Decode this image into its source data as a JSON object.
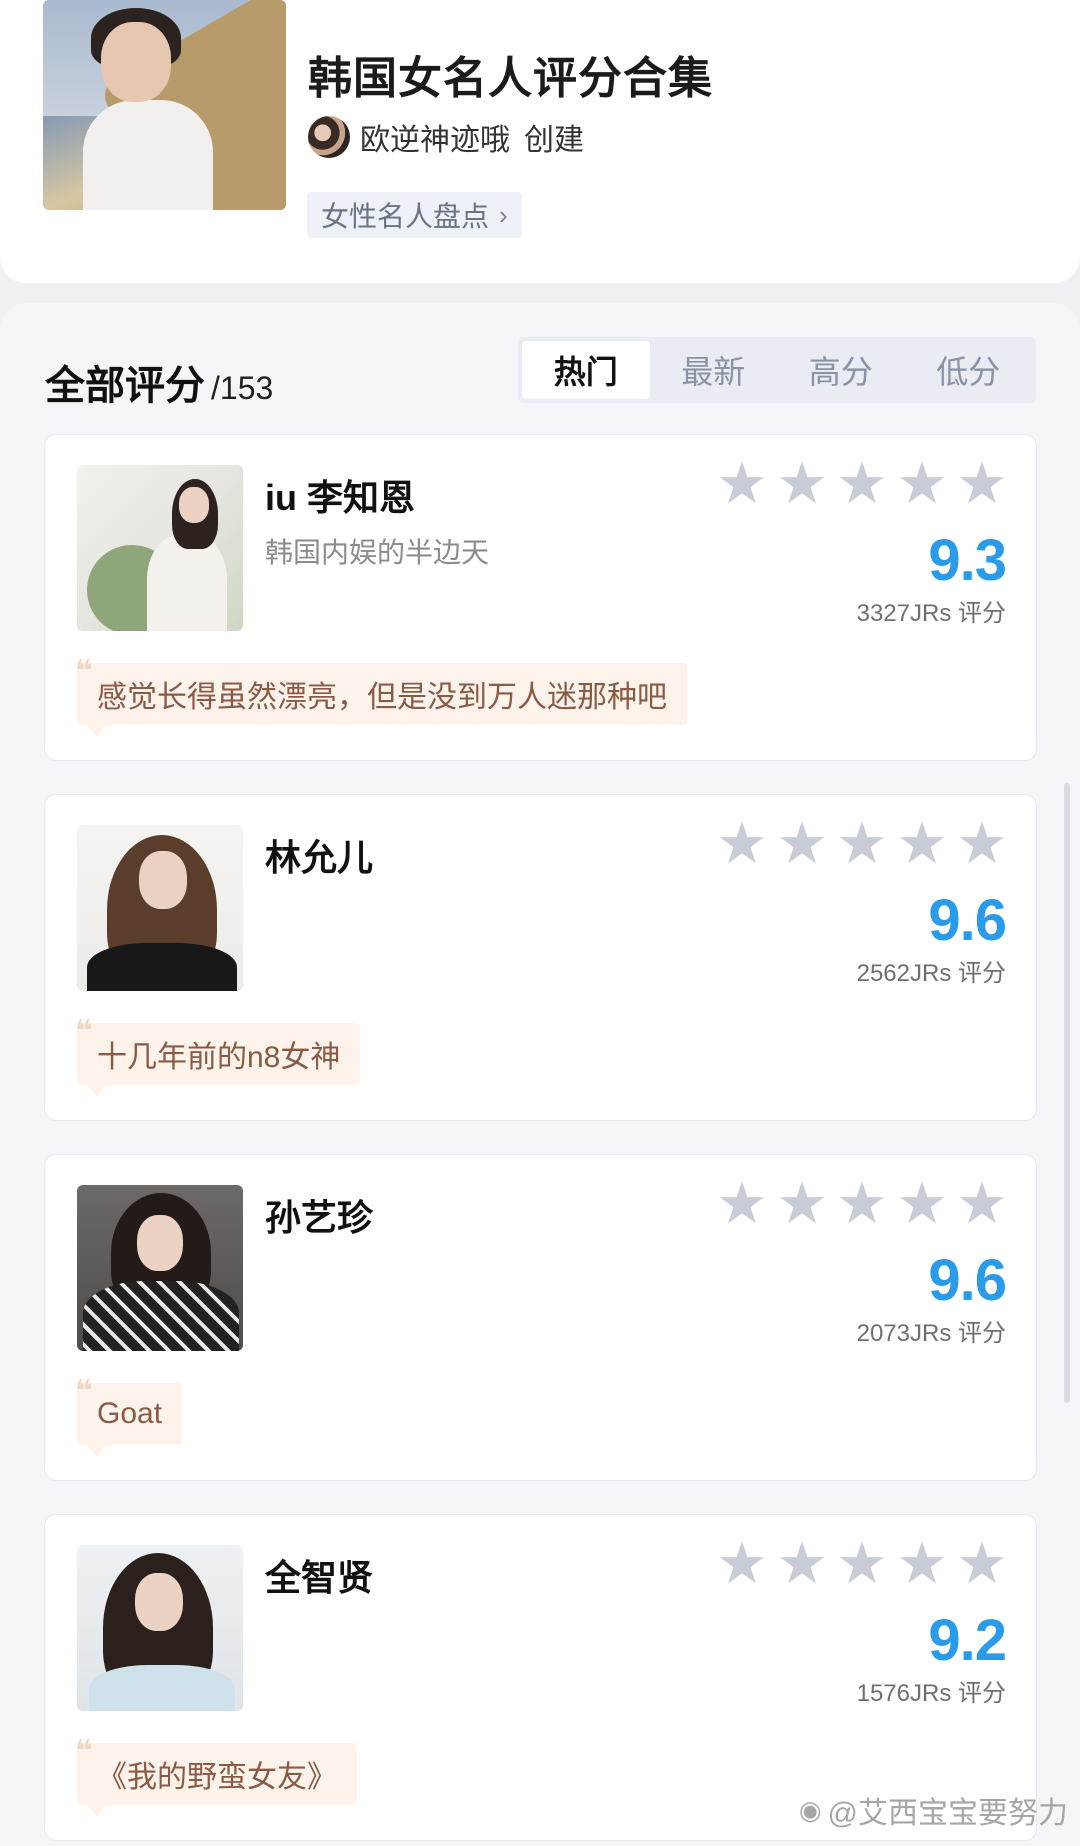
{
  "header": {
    "title": "韩国女名人评分合集",
    "creator_name": "欧逆神迹哦",
    "creator_suffix": "创建",
    "tag": "女性名人盘点"
  },
  "section": {
    "title": "全部评分",
    "count": "/153"
  },
  "tabs": [
    {
      "label": "热门",
      "active": true
    },
    {
      "label": "最新",
      "active": false
    },
    {
      "label": "高分",
      "active": false
    },
    {
      "label": "低分",
      "active": false
    }
  ],
  "items": [
    {
      "name": "iu 李知恩",
      "subtitle": "韩国内娱的半边天",
      "score": "9.3",
      "rating_count": "3327JRs 评分",
      "comment": "感觉长得虽然漂亮，但是没到万人迷那种吧",
      "stars": 5
    },
    {
      "name": "林允儿",
      "subtitle": "",
      "score": "9.6",
      "rating_count": "2562JRs 评分",
      "comment": "十几年前的n8女神",
      "stars": 5
    },
    {
      "name": "孙艺珍",
      "subtitle": "",
      "score": "9.6",
      "rating_count": "2073JRs 评分",
      "comment": "Goat",
      "stars": 5
    },
    {
      "name": "全智贤",
      "subtitle": "",
      "score": "9.2",
      "rating_count": "1576JRs 评分",
      "comment": "《我的野蛮女友》",
      "stars": 5
    }
  ],
  "watermark": "@艾西宝宝要努力",
  "colors": {
    "score": "#2a9be9",
    "star": "#c8ccd6",
    "comment_bg": "#fdf3ea",
    "comment_text": "#8a5a45"
  }
}
